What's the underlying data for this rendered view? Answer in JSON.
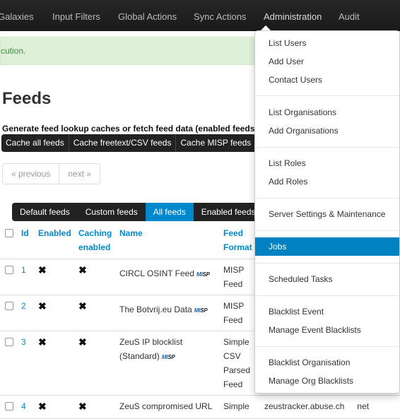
{
  "navbar": {
    "items": [
      {
        "label": "Galaxies"
      },
      {
        "label": "Input Filters"
      },
      {
        "label": "Global Actions"
      },
      {
        "label": "Sync Actions"
      },
      {
        "label": "Administration"
      },
      {
        "label": "Audit"
      }
    ]
  },
  "flash": {
    "message": "cution."
  },
  "page": {
    "title": "Feeds",
    "subtitle": "Generate feed lookup caches or fetch feed data (enabled feeds"
  },
  "cache_buttons": [
    "Cache all feeds",
    "Cache freetext/CSV feeds",
    "Cache MISP feeds"
  ],
  "pager": {
    "previous": "« previous",
    "next": "next »"
  },
  "tabs": [
    "Default feeds",
    "Custom feeds",
    "All feeds",
    "Enabled feeds"
  ],
  "table": {
    "headers": {
      "id": "Id",
      "enabled": "Enabled",
      "caching_1": "Caching",
      "caching_2": "enabled",
      "name": "Name",
      "format_1": "Feed",
      "format_2": "Format"
    },
    "rows": [
      {
        "id": "1",
        "enabled": "✖",
        "caching": "✖",
        "name_1": "CIRCL OSINT Feed",
        "name_2": "",
        "format": [
          "MISP",
          "Feed"
        ],
        "extra": ""
      },
      {
        "id": "2",
        "enabled": "✖",
        "caching": "✖",
        "name_1": "The Botvrij.eu Data",
        "name_2": "",
        "format": [
          "MISP",
          "Feed"
        ],
        "extra": ""
      },
      {
        "id": "3",
        "enabled": "✖",
        "caching": "✖",
        "name_1": "ZeuS IP blocklist",
        "name_2": "(Standard)",
        "format": [
          "Simple",
          "CSV",
          "Parsed",
          "Feed"
        ],
        "extra": ""
      },
      {
        "id": "4",
        "enabled": "✖",
        "caching": "✖",
        "name_1": "ZeuS compromised URL",
        "name_2": "",
        "format": [
          "Simple"
        ],
        "extra": "zeustracker.abuse.ch",
        "extra2": "net"
      }
    ],
    "misp_badge": {
      "mi": "MI",
      "sp": "SP"
    }
  },
  "dropdown": {
    "groups": [
      [
        "List Users",
        "Add User",
        "Contact Users"
      ],
      [
        "List Organisations",
        "Add Organisations"
      ],
      [
        "List Roles",
        "Add Roles"
      ],
      [
        "Server Settings & Maintenance"
      ],
      [
        "Jobs"
      ],
      [
        "Scheduled Tasks"
      ],
      [
        "Blacklist Event",
        "Manage Event Blacklists"
      ],
      [
        "Blacklist Organisation",
        "Manage Org Blacklists"
      ]
    ],
    "active_item": "Jobs"
  },
  "colors": {
    "accent": "#0088cc",
    "navbar": "#1b1b1b",
    "success_bg": "#dff0d8",
    "dropdown_active": "#0081c2"
  }
}
